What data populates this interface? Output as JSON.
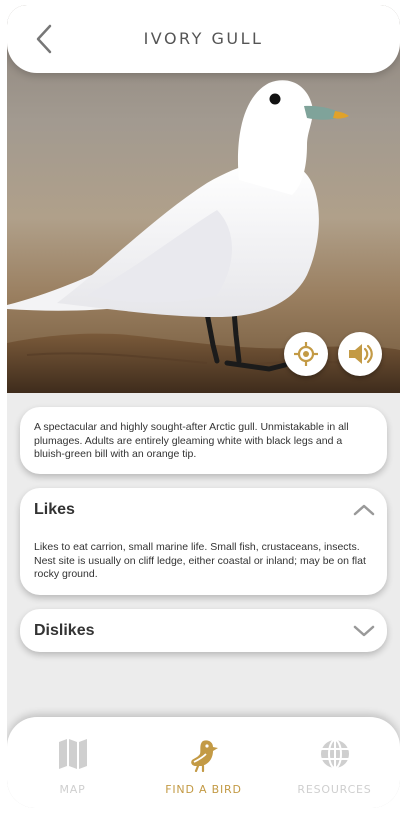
{
  "header": {
    "title": "IVORY GULL",
    "back_icon": "chevron-left-icon"
  },
  "hero": {
    "locate_icon": "crosshair-icon",
    "sound_icon": "speaker-icon"
  },
  "description": {
    "text": "A spectacular and highly sought-after Arctic gull. Unmistakable in all plumages. Adults are entirely gleaming white with black legs and a bluish-green bill with an orange tip."
  },
  "likes": {
    "heading": "Likes",
    "text": "Likes to eat carrion, small marine life. Small fish, crustaceans, insects. Nest site is usually on cliff ledge, either coastal or inland; may be on flat rocky ground.",
    "expanded": true,
    "icon": "chevron-up-icon"
  },
  "dislikes": {
    "heading": "Dislikes",
    "expanded": false,
    "icon": "chevron-down-icon"
  },
  "nav": {
    "items": [
      {
        "label": "MAP",
        "icon": "map-icon",
        "active": false
      },
      {
        "label": "FIND A BIRD",
        "icon": "bird-icon",
        "active": true
      },
      {
        "label": "RESOURCES",
        "icon": "globe-icon",
        "active": false
      }
    ]
  },
  "colors": {
    "accent": "#c39a45",
    "inactive": "#cfcfcf",
    "background": "#ececec"
  }
}
